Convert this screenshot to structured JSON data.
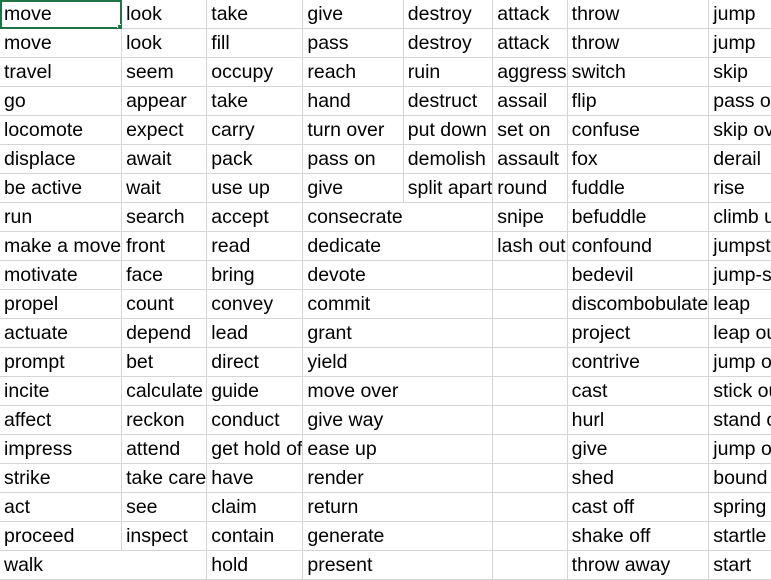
{
  "grid": {
    "rows": [
      [
        "move",
        "look",
        "take",
        "give",
        "destroy",
        "attack",
        "throw",
        "jump"
      ],
      [
        "move",
        "look",
        "fill",
        "pass",
        "destroy",
        "attack",
        "throw",
        "jump"
      ],
      [
        "travel",
        "seem",
        "occupy",
        "reach",
        "ruin",
        "aggress",
        "switch",
        "skip"
      ],
      [
        "go",
        "appear",
        "take",
        "hand",
        "destruct",
        "assail",
        "flip",
        "pass over"
      ],
      [
        "locomote",
        "expect",
        "carry",
        "turn over",
        "put down",
        "set on",
        "confuse",
        "skip over"
      ],
      [
        "displace",
        "await",
        "pack",
        "pass on",
        "demolish",
        "assault",
        "fox",
        "derail"
      ],
      [
        "be active",
        "wait",
        "use up",
        "give",
        "split apart",
        "round",
        "fuddle",
        "rise"
      ],
      [
        "run",
        "search",
        "accept",
        "consecrate",
        "",
        "snipe",
        "befuddle",
        "climb up"
      ],
      [
        "make a move",
        "front",
        "read",
        "dedicate",
        "",
        "lash out",
        "confound",
        "jumpstart"
      ],
      [
        "motivate",
        "face",
        "bring",
        "devote",
        "",
        "",
        "bedevil",
        "jump-start"
      ],
      [
        "propel",
        "count",
        "convey",
        "commit",
        "",
        "",
        "discombobulate",
        "leap"
      ],
      [
        "actuate",
        "depend",
        "lead",
        "grant",
        "",
        "",
        "project",
        "leap out"
      ],
      [
        "prompt",
        "bet",
        "direct",
        "yield",
        "",
        "",
        "contrive",
        "jump out"
      ],
      [
        "incite",
        "calculate",
        "guide",
        "move over",
        "",
        "",
        "cast",
        "stick out"
      ],
      [
        "affect",
        "reckon",
        "conduct",
        "give way",
        "",
        "",
        "hurl",
        "stand out"
      ],
      [
        "impress",
        "attend",
        "get hold of",
        "ease up",
        "",
        "",
        "give",
        "jump off"
      ],
      [
        "strike",
        "take care",
        "have",
        "render",
        "",
        "",
        "shed",
        "bound"
      ],
      [
        "act",
        "see",
        "claim",
        "return",
        "",
        "",
        "cast off",
        "spring"
      ],
      [
        "proceed",
        "inspect",
        "contain",
        "generate",
        "",
        "",
        "shake off",
        "startle"
      ],
      [
        "walk",
        "",
        "hold",
        "present",
        "",
        "",
        "throw away",
        "start"
      ]
    ]
  }
}
